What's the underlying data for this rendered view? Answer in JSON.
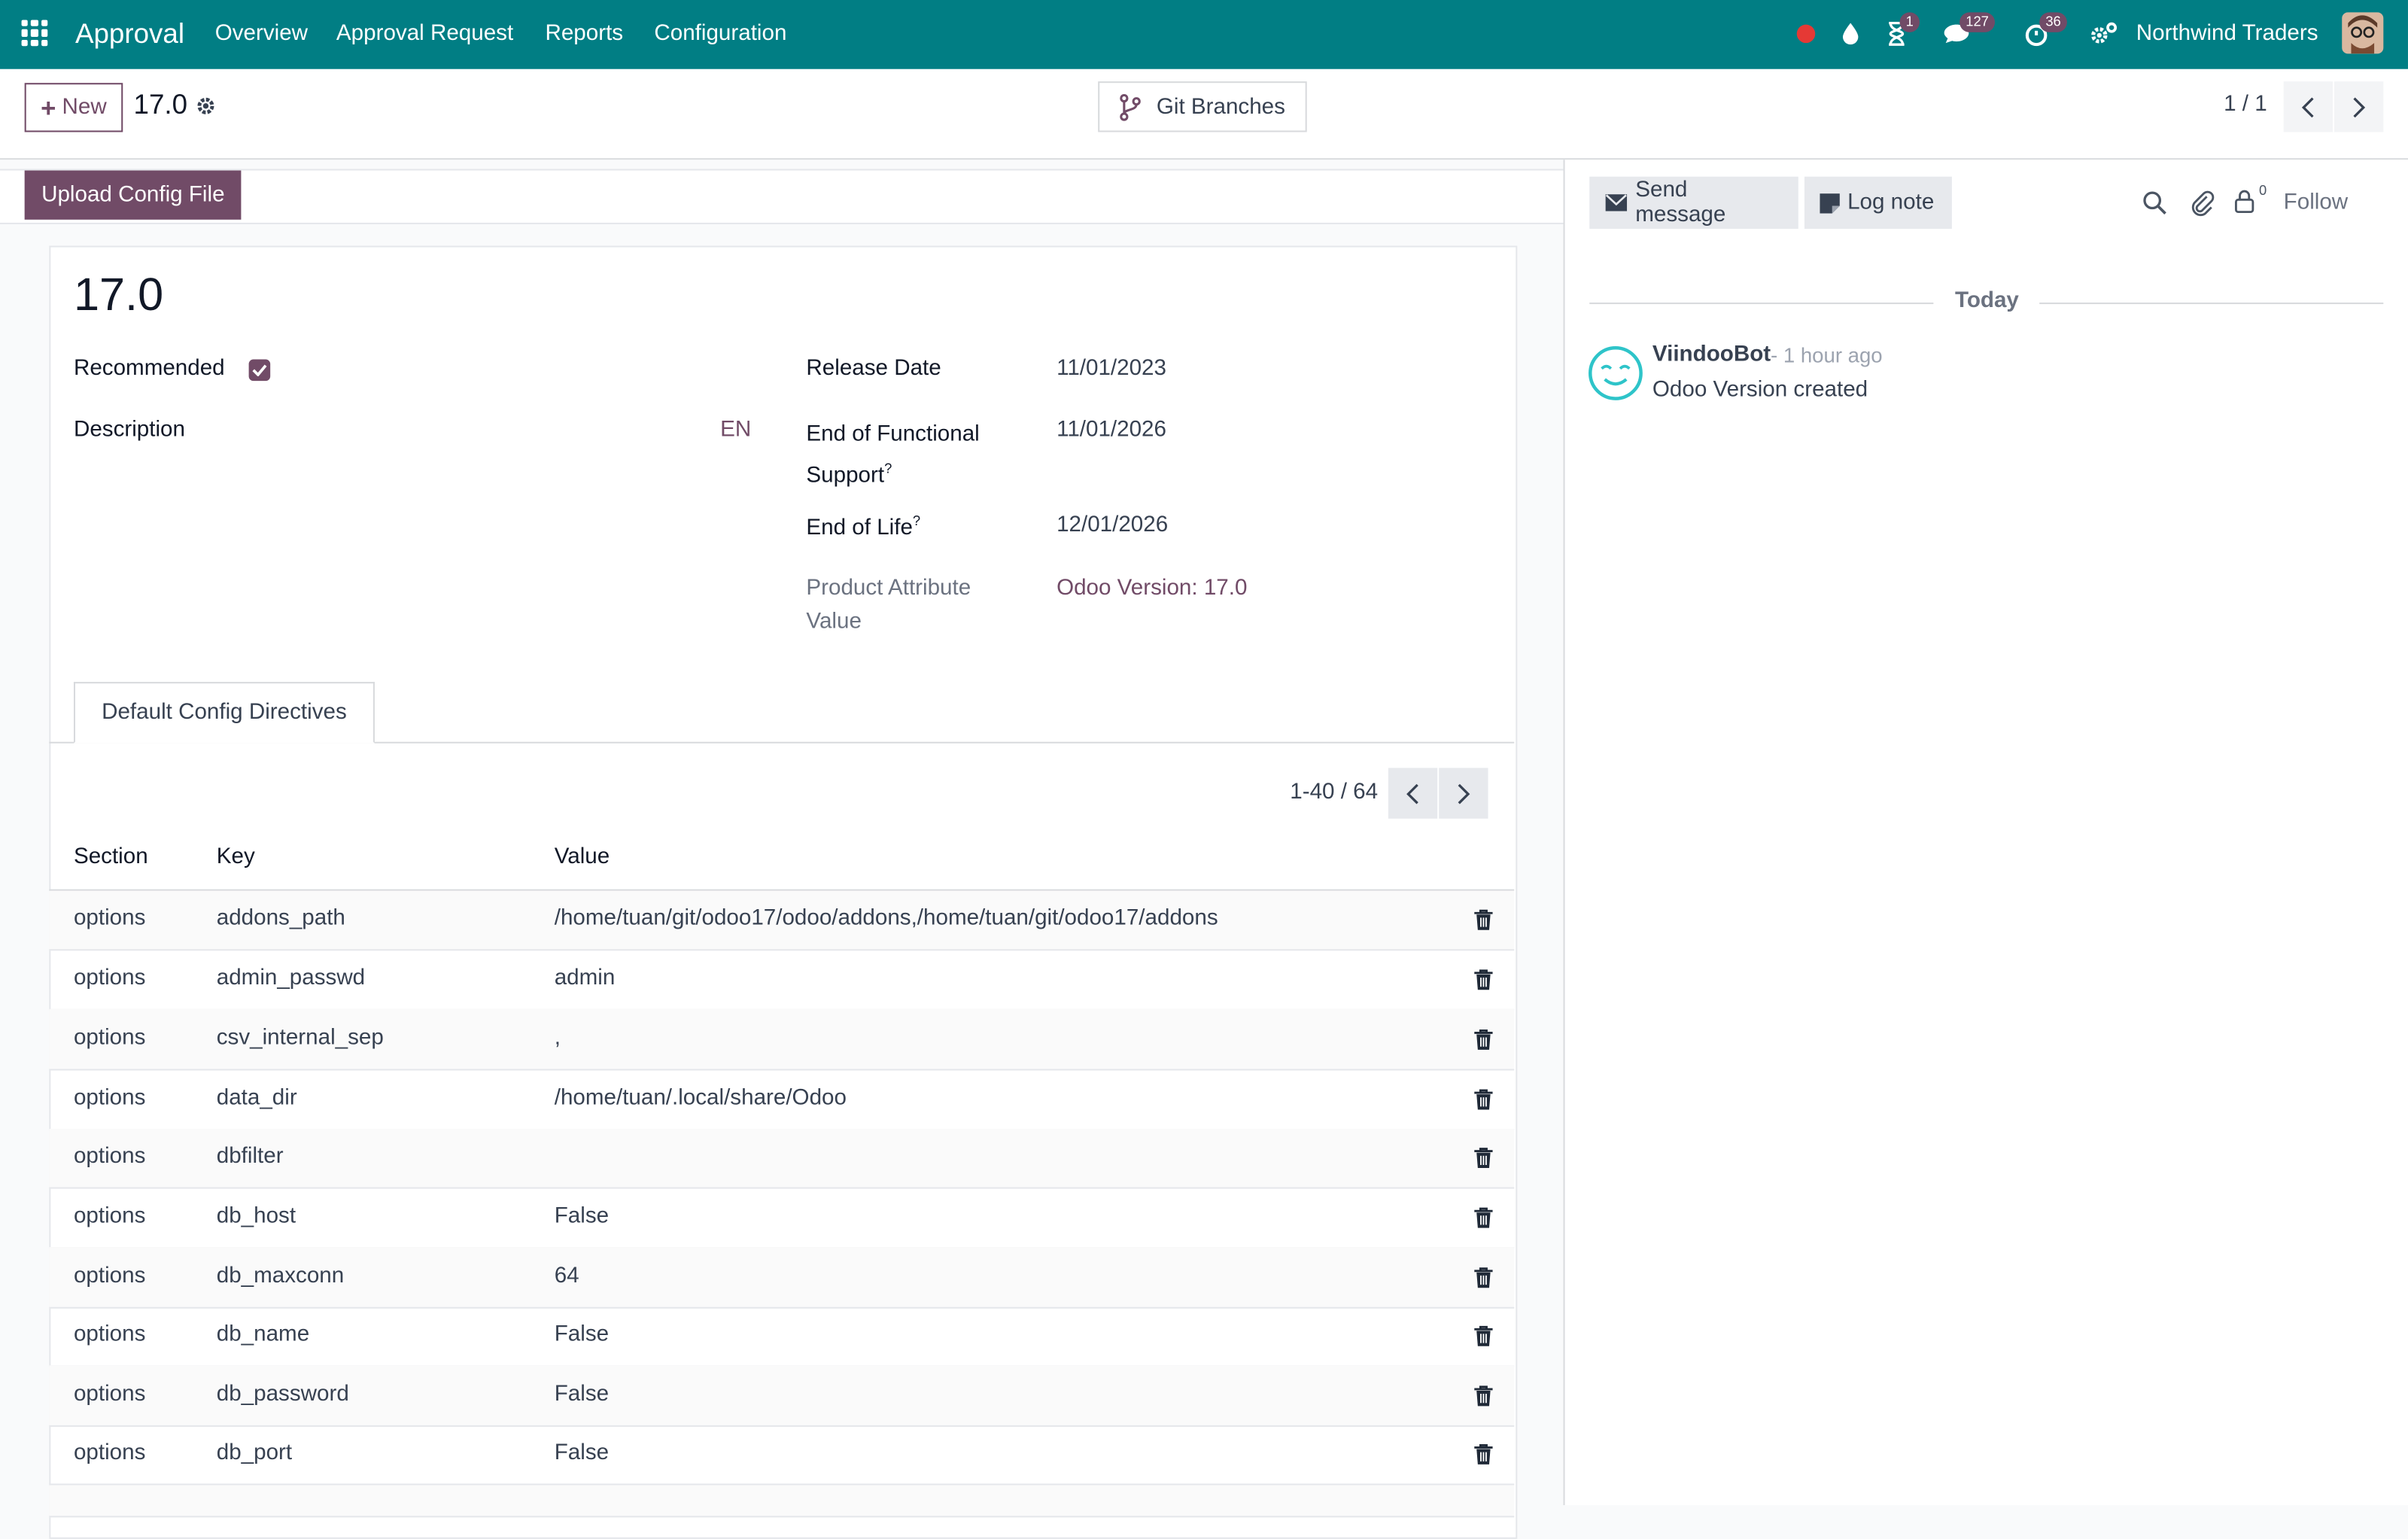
{
  "navbar": {
    "app_name": "Approval",
    "menus": [
      "Overview",
      "Approval Request",
      "Reports",
      "Configuration"
    ],
    "activity_badge": "1",
    "messages_badge": "127",
    "timer_badge": "36",
    "company": "Northwind Traders"
  },
  "control_panel": {
    "new_label": "New",
    "breadcrumb": "17.0",
    "git_branches_label": "Git Branches",
    "pager": "1 / 1"
  },
  "statusbar": {
    "upload_label": "Upload Config File"
  },
  "record": {
    "title": "17.0",
    "recommended_label": "Recommended",
    "recommended_checked": true,
    "description_label": "Description",
    "description_lang": "EN",
    "release_date_label": "Release Date",
    "release_date": "11/01/2023",
    "end_functional_label_1": "End of Functional",
    "end_functional_label_2": "Support",
    "end_functional_date": "11/01/2026",
    "end_of_life_label": "End of Life",
    "end_of_life_date": "12/01/2026",
    "tooltip_marker": "?",
    "attr_value_label_1": "Product Attribute",
    "attr_value_label_2": "Value",
    "attr_value": "Odoo Version: 17.0"
  },
  "tab": {
    "label": "Default Config Directives"
  },
  "table": {
    "pager": "1-40 / 64",
    "headers": {
      "section": "Section",
      "key": "Key",
      "value": "Value"
    },
    "rows": [
      {
        "section": "options",
        "key": "addons_path",
        "value": "/home/tuan/git/odoo17/odoo/addons,/home/tuan/git/odoo17/addons"
      },
      {
        "section": "options",
        "key": "admin_passwd",
        "value": "admin"
      },
      {
        "section": "options",
        "key": "csv_internal_sep",
        "value": ","
      },
      {
        "section": "options",
        "key": "data_dir",
        "value": "/home/tuan/.local/share/Odoo"
      },
      {
        "section": "options",
        "key": "dbfilter",
        "value": ""
      },
      {
        "section": "options",
        "key": "db_host",
        "value": "False"
      },
      {
        "section": "options",
        "key": "db_maxconn",
        "value": "64"
      },
      {
        "section": "options",
        "key": "db_name",
        "value": "False"
      },
      {
        "section": "options",
        "key": "db_password",
        "value": "False"
      },
      {
        "section": "options",
        "key": "db_port",
        "value": "False"
      }
    ]
  },
  "chatter": {
    "send_message_label": "Send message",
    "log_note_label": "Log note",
    "follower_count": "0",
    "follow_label": "Follow",
    "date_separator": "Today",
    "messages": [
      {
        "author": "ViindooBot",
        "time": "- 1 hour ago",
        "body": "Odoo Version created"
      }
    ]
  },
  "colors": {
    "navbar": "#017e84",
    "primary": "#714b67",
    "record_indicator": "#e53935"
  }
}
